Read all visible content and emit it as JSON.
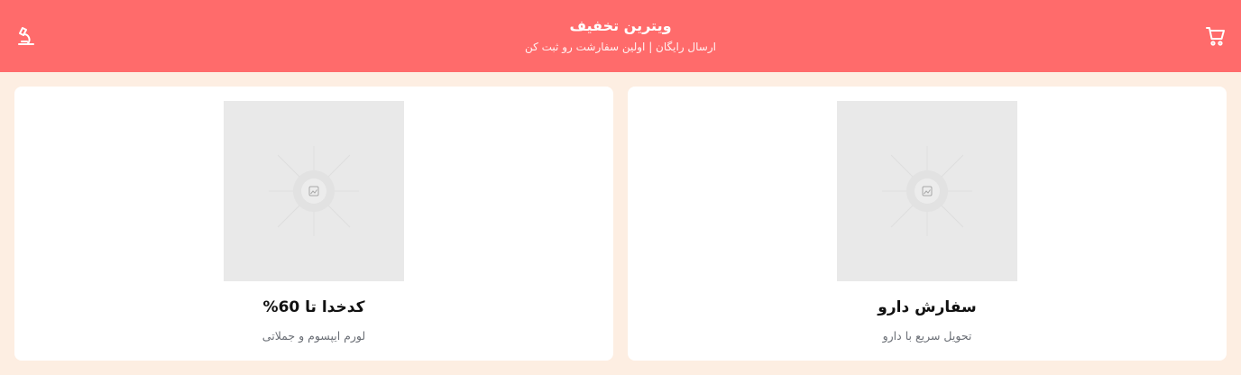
{
  "colors": {
    "background": "#fdeee2",
    "header": "#ff6b6b",
    "card": "#ffffff",
    "image_placeholder": "#e9e9e9",
    "title_text": "#111111",
    "muted_text": "#6b6f76"
  },
  "header": {
    "title": "ویترین تخفیف",
    "subtitle": "ارسال رایگان | اولین سفارشت رو ثبت کن",
    "cart_icon": "shopping-cart-icon",
    "lab_icon": "microscope-icon"
  },
  "cards": [
    {
      "title": "سفارش دارو",
      "description": "تحویل سریع با دارو",
      "image_icon": "image-placeholder-icon"
    },
    {
      "title": "کدخدا تا 60%",
      "description": "لورم ایپسوم و جملاتی",
      "image_icon": "image-placeholder-icon"
    }
  ]
}
